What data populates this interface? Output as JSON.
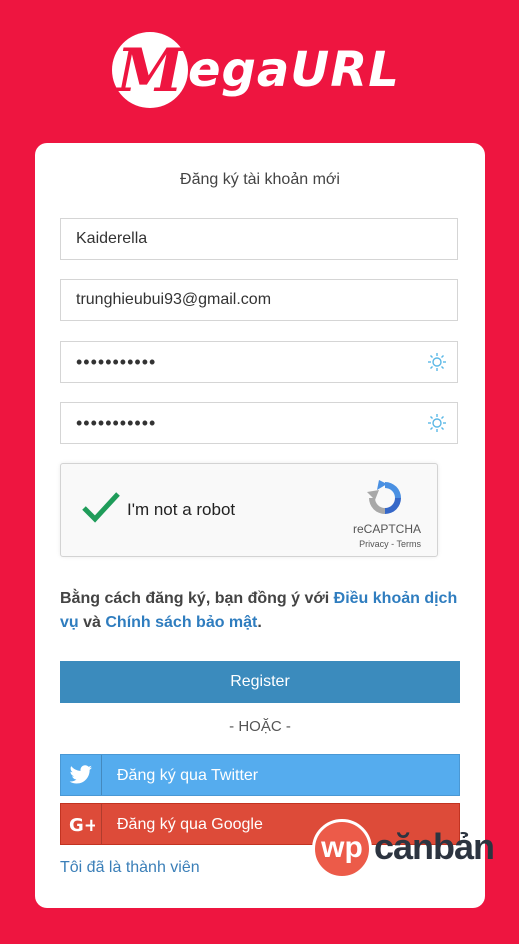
{
  "brand": {
    "logo_letter": "M",
    "logo_text": "egaURL"
  },
  "form": {
    "title": "Đăng ký tài khoản mới",
    "username_value": "Kaiderella",
    "email_value": "trunghieubui93@gmail.com",
    "password_value": "•••••••••••",
    "confirm_value": "•••••••••••"
  },
  "captcha": {
    "label": "I'm not a robot",
    "brand": "reCAPTCHA",
    "links": "Privacy - Terms"
  },
  "terms": {
    "prefix": "Bằng cách đăng ký, bạn đồng ý với ",
    "tos_link": "Điều khoản dịch vụ",
    "middle": " và ",
    "privacy_link": "Chính sách bảo mật",
    "suffix": "."
  },
  "buttons": {
    "register": "Register",
    "or": "- HOẶC -",
    "twitter": "Đăng ký qua Twitter",
    "google": "Đăng ký qua Google",
    "member_link": "Tôi đã là thành viên"
  },
  "watermark": {
    "circle_text": "wp",
    "text": "cănbản"
  },
  "icons": {
    "password_reveal": "eye-icon",
    "twitter": "twitter-icon",
    "google": "google-plus-icon",
    "check": "check-icon",
    "recaptcha": "recaptcha-icon"
  },
  "colors": {
    "background": "#ee1540",
    "register": "#3b8bbd",
    "twitter": "#55acee",
    "google": "#dd4b39",
    "link": "#2f7dbf"
  }
}
